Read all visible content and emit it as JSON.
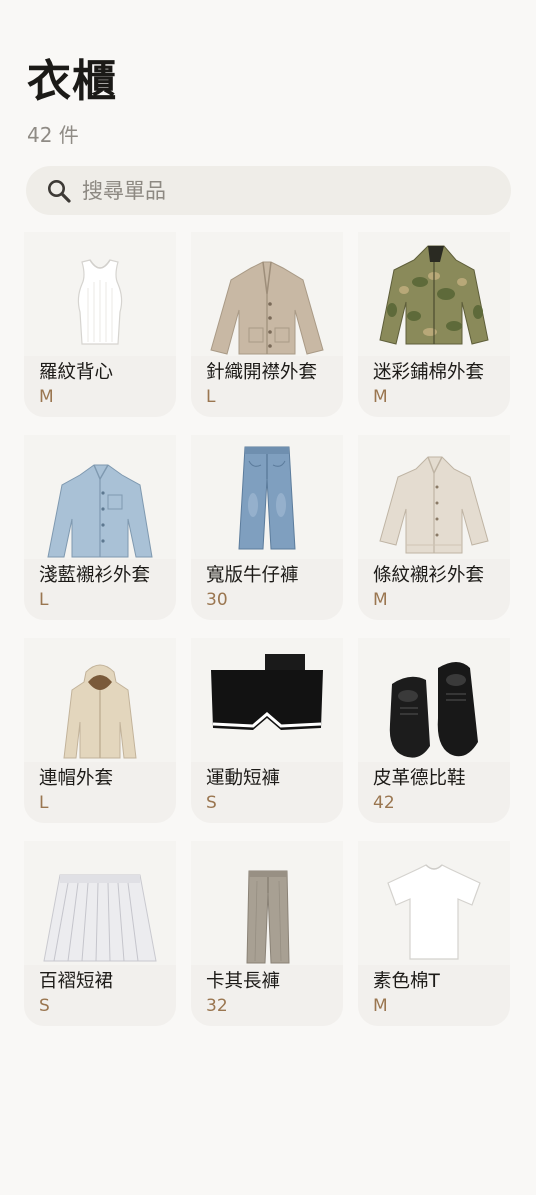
{
  "header": {
    "title": "衣櫃",
    "count": "42 件"
  },
  "search": {
    "placeholder": "搜尋單品",
    "value": ""
  },
  "colors": {
    "background": "#f9f8f6",
    "card": "#f2f0ed",
    "size_accent": "#9a7650",
    "search_bg": "#efede8"
  },
  "items": [
    {
      "name": "羅紋背心",
      "size": "M",
      "icon": "tank-top-icon"
    },
    {
      "name": "針織開襟外套",
      "size": "L",
      "icon": "cardigan-icon"
    },
    {
      "name": "迷彩鋪棉外套",
      "size": "M",
      "icon": "camo-jacket-icon"
    },
    {
      "name": "淺藍襯衫外套",
      "size": "L",
      "icon": "blue-shirt-jacket-icon"
    },
    {
      "name": "寬版牛仔褲",
      "size": "30",
      "icon": "jeans-icon"
    },
    {
      "name": "條紋襯衫外套",
      "size": "M",
      "icon": "striped-shirt-jacket-icon"
    },
    {
      "name": "連帽外套",
      "size": "L",
      "icon": "hooded-jacket-icon"
    },
    {
      "name": "運動短褲",
      "size": "S",
      "icon": "sport-shorts-icon"
    },
    {
      "name": "皮革德比鞋",
      "size": "42",
      "icon": "derby-shoes-icon"
    },
    {
      "name": "百褶短裙",
      "size": "S",
      "icon": "pleated-skirt-icon"
    },
    {
      "name": "卡其長褲",
      "size": "32",
      "icon": "khaki-trousers-icon"
    },
    {
      "name": "素色棉T",
      "size": "M",
      "icon": "plain-tshirt-icon"
    }
  ]
}
